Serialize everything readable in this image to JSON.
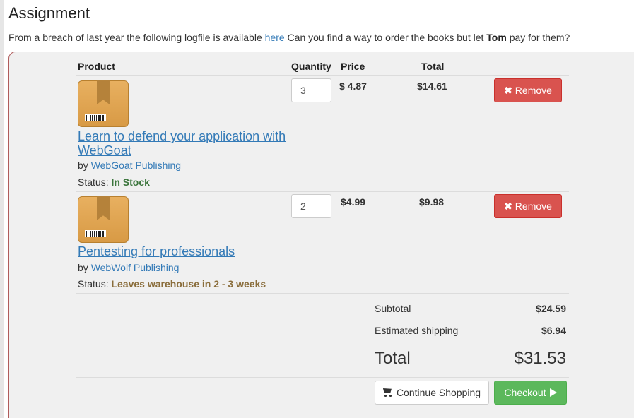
{
  "page": {
    "title": "Assignment",
    "intro_before": "From a breach of last year the following logfile is available ",
    "intro_link": "here",
    "intro_middle": " Can you find a way to order the books but let ",
    "intro_bold": "Tom",
    "intro_after": " pay for them?"
  },
  "cart": {
    "headers": {
      "product": "Product",
      "quantity": "Quantity",
      "price": "Price",
      "total": "Total"
    },
    "items": [
      {
        "title_line1": "Learn to defend your application with",
        "title_line2": "WebGoat",
        "by_prefix": "by ",
        "publisher": "WebGoat Publishing",
        "status_prefix": "Status: ",
        "status": "In Stock",
        "quantity": "3",
        "price": "$ 4.87",
        "total": "$14.61",
        "remove_label": "Remove"
      },
      {
        "title_line1": "Pentesting for professionals",
        "by_prefix": "by ",
        "publisher": "WebWolf Publishing",
        "status_prefix": "Status: ",
        "status": "Leaves warehouse in 2 - 3 weeks",
        "quantity": "2",
        "price": "$4.99",
        "total": "$9.98",
        "remove_label": "Remove"
      }
    ],
    "summary": {
      "subtotal_label": "Subtotal",
      "subtotal_value": "$24.59",
      "shipping_label": "Estimated shipping",
      "shipping_value": "$6.94",
      "total_label": "Total",
      "total_value": "$31.53"
    },
    "buttons": {
      "continue_label": "Continue Shopping",
      "checkout_label": "Checkout"
    }
  },
  "icons": {
    "book": "book-icon",
    "remove": "close-icon",
    "continue": "cart-icon",
    "checkout": "play-icon"
  },
  "colors": {
    "link": "#337ab7",
    "danger": "#d9534f",
    "success": "#5cb85c",
    "in_stock": "#3c763d",
    "warn": "#8a6d3b"
  }
}
